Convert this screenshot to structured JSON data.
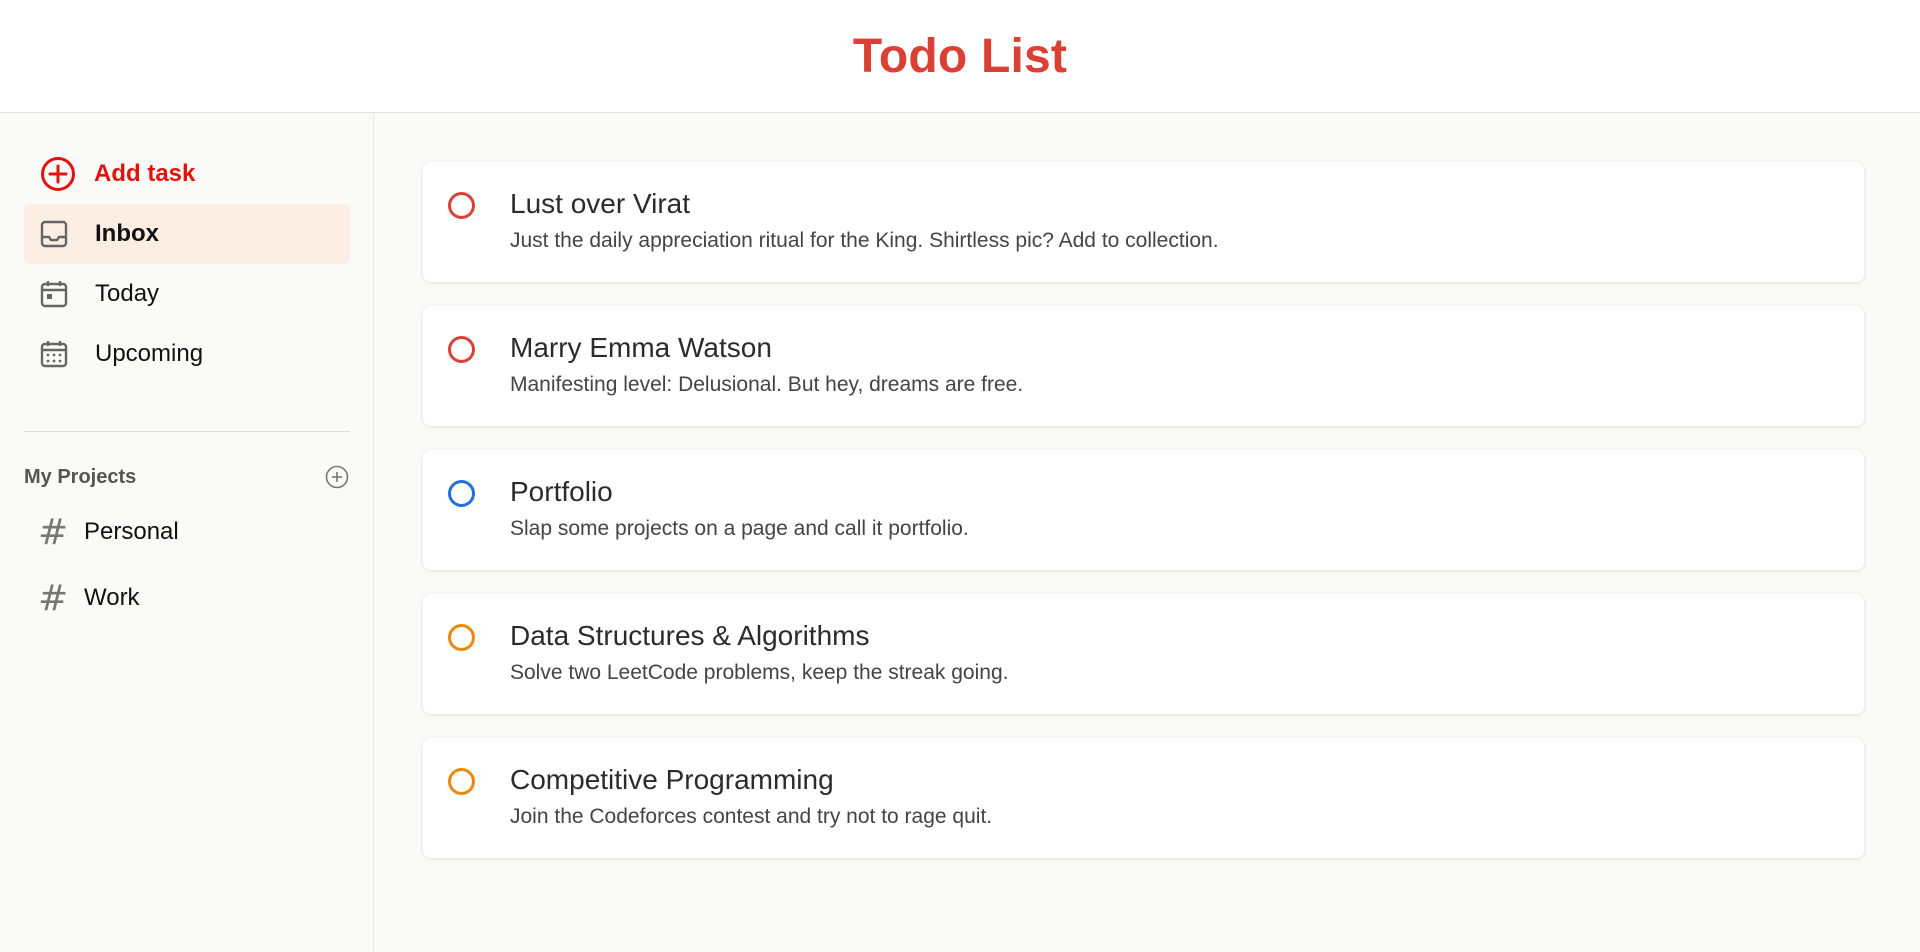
{
  "header": {
    "title": "Todo List"
  },
  "sidebar": {
    "add_task_label": "Add task",
    "nav": [
      {
        "label": "Inbox",
        "icon": "inbox-icon",
        "active": true
      },
      {
        "label": "Today",
        "icon": "calendar-today-icon",
        "active": false
      },
      {
        "label": "Upcoming",
        "icon": "calendar-upcoming-icon",
        "active": false
      }
    ],
    "projects_title": "My Projects",
    "projects": [
      {
        "label": "Personal",
        "icon": "hash-icon"
      },
      {
        "label": "Work",
        "icon": "hash-icon"
      }
    ]
  },
  "tasks": [
    {
      "title": "Lust over Virat",
      "description": "Just the daily appreciation ritual for the King. Shirtless pic? Add to collection.",
      "priority_color": "#db4035"
    },
    {
      "title": "Marry Emma Watson",
      "description": "Manifesting level: Delusional. But hey, dreams are free.",
      "priority_color": "#db4035"
    },
    {
      "title": "Portfolio",
      "description": "Slap some projects on a page and call it portfolio.",
      "priority_color": "#246fe0"
    },
    {
      "title": "Data Structures & Algorithms",
      "description": "Solve two LeetCode problems, keep the streak going.",
      "priority_color": "#eb8909"
    },
    {
      "title": "Competitive Programming",
      "description": "Join the Codeforces contest and try not to rage quit.",
      "priority_color": "#eb8909"
    }
  ],
  "colors": {
    "accent": "#db4035",
    "add_task": "#e3120b",
    "active_bg": "#fdeee4"
  }
}
